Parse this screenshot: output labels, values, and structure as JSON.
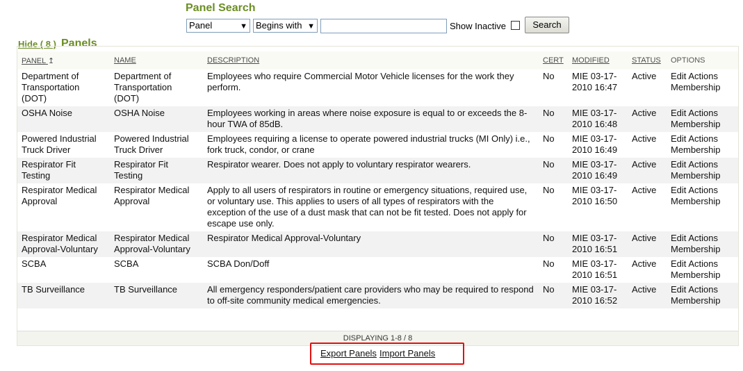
{
  "search": {
    "title": "Panel Search",
    "field_select": "Panel",
    "match_select": "Begins with",
    "text_value": "",
    "show_inactive_label": "Show Inactive",
    "search_button": "Search"
  },
  "panels": {
    "hide_link": "Hide ( 8 )",
    "title": "Panels",
    "columns": {
      "panel": "PANEL",
      "name": "NAME",
      "description": "DESCRIPTION",
      "cert": "CERT",
      "modified": "MODIFIED",
      "status": "STATUS",
      "options": "OPTIONS"
    },
    "sort_indicator": "↥",
    "rows": [
      {
        "panel": "Department of Transportation (DOT)",
        "name": "Department of Transportation (DOT)",
        "description": "Employees who require Commercial Motor Vehicle licenses for the work they perform.",
        "cert": "No",
        "modified": "MIE 03-17-2010 16:47",
        "status": "Active",
        "opt_edit": "Edit",
        "opt_actions": "Actions",
        "opt_membership": "Membership"
      },
      {
        "panel": "OSHA Noise",
        "name": "OSHA Noise",
        "description": "Employees working in areas where noise exposure is equal to or exceeds the 8-hour TWA of 85dB.",
        "cert": "No",
        "modified": "MIE 03-17-2010 16:48",
        "status": "Active",
        "opt_edit": "Edit",
        "opt_actions": "Actions",
        "opt_membership": "Membership"
      },
      {
        "panel": "Powered Industrial Truck Driver",
        "name": "Powered Industrial Truck Driver",
        "description": "Employees requiring a license to operate powered industrial trucks (MI Only) i.e., fork truck, condor, or crane",
        "cert": "No",
        "modified": "MIE 03-17-2010 16:49",
        "status": "Active",
        "opt_edit": "Edit",
        "opt_actions": "Actions",
        "opt_membership": "Membership"
      },
      {
        "panel": "Respirator Fit Testing",
        "name": "Respirator Fit Testing",
        "description": "Respirator wearer. Does not apply to voluntary respirator wearers.",
        "cert": "No",
        "modified": "MIE 03-17-2010 16:49",
        "status": "Active",
        "opt_edit": "Edit",
        "opt_actions": "Actions",
        "opt_membership": "Membership"
      },
      {
        "panel": "Respirator Medical Approval",
        "name": "Respirator Medical Approval",
        "description": "Apply to all users of respirators in routine or emergency situations, required use, or voluntary use. This applies to users of all types of respirators with the exception of the use of a dust mask that can not be fit tested. Does not apply for escape use only.",
        "cert": "No",
        "modified": "MIE 03-17-2010 16:50",
        "status": "Active",
        "opt_edit": "Edit",
        "opt_actions": "Actions",
        "opt_membership": "Membership"
      },
      {
        "panel": "Respirator Medical Approval-Voluntary",
        "name": "Respirator Medical Approval-Voluntary",
        "description": "Respirator Medical Approval-Voluntary",
        "cert": "No",
        "modified": "MIE 03-17-2010 16:51",
        "status": "Active",
        "opt_edit": "Edit",
        "opt_actions": "Actions",
        "opt_membership": "Membership"
      },
      {
        "panel": "SCBA",
        "name": "SCBA",
        "description": "SCBA Don/Doff",
        "cert": "No",
        "modified": "MIE 03-17-2010 16:51",
        "status": "Active",
        "opt_edit": "Edit",
        "opt_actions": "Actions",
        "opt_membership": "Membership"
      },
      {
        "panel": "TB Surveillance",
        "name": "TB Surveillance",
        "description": "All emergency responders/patient care providers who may be required to respond to off-site community medical emergencies.",
        "cert": "No",
        "modified": "MIE 03-17-2010 16:52",
        "status": "Active",
        "opt_edit": "Edit",
        "opt_actions": "Actions",
        "opt_membership": "Membership"
      }
    ],
    "displaying": "DISPLAYING 1-8 / 8"
  },
  "actions": {
    "export": "Export Panels",
    "import": "Import Panels"
  }
}
